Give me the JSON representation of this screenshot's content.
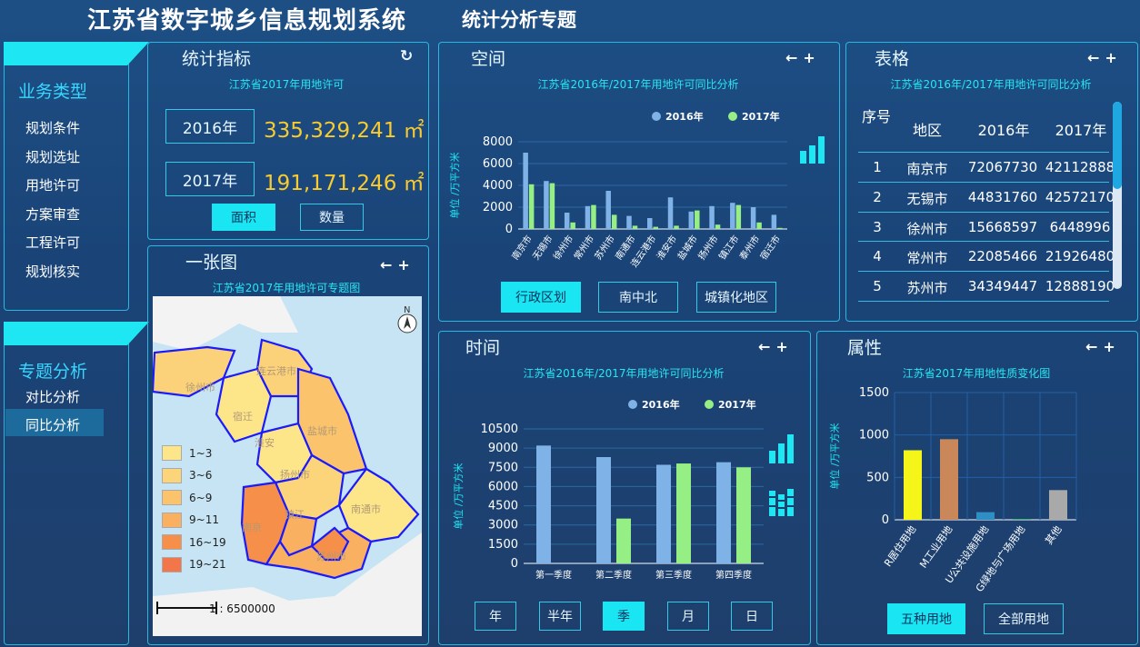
{
  "header": {
    "title": "江苏省数字城乡信息规划系统",
    "subtitle": "统计分析专题"
  },
  "sidebar": {
    "section1": "业务类型",
    "items1": [
      "规划条件",
      "规划选址",
      "用地许可",
      "方案审查",
      "工程许可",
      "规划核实"
    ],
    "section2": "专题分析",
    "items2": [
      "对比分析",
      "同比分析"
    ]
  },
  "stats": {
    "title": "统计指标",
    "subtitle": "江苏省2017年用地许可",
    "row1_year": "2016年",
    "row1_value": "335,329,241 ㎡",
    "row2_year": "2017年",
    "row2_value": "191,171,246 ㎡",
    "btn_area": "面积",
    "btn_count": "数量"
  },
  "map": {
    "title": "一张图",
    "subtitle": "江苏省2017年用地许可专题图",
    "north": "N",
    "scale": "1 : 6500000",
    "legend": [
      "1~3",
      "3~6",
      "6~9",
      "9~11",
      "16~19",
      "19~21"
    ],
    "legend_colors": [
      "#fde58a",
      "#fcd57a",
      "#fbc46c",
      "#f9b060",
      "#f58f4a",
      "#f2764a"
    ],
    "cities": [
      "连云港市",
      "徐州市",
      "宿迁",
      "盐城市",
      "淮安",
      "扬州市",
      "南通市",
      "南京",
      "镇江",
      "苏州市"
    ]
  },
  "space": {
    "title": "空间",
    "subtitle": "江苏省2016年/2017年用地许可同比分析",
    "btns": [
      "行政区划",
      "南中北",
      "城镇化地区"
    ]
  },
  "table": {
    "title": "表格",
    "subtitle": "江苏省2016年/2017年用地许可同比分析",
    "headers": [
      "序号",
      "地区",
      "2016年",
      "2017年"
    ],
    "rows": [
      [
        "1",
        "南京市",
        "72067730",
        "42112888"
      ],
      [
        "2",
        "无锡市",
        "44831760",
        "42572170"
      ],
      [
        "3",
        "徐州市",
        "15668597",
        "6448996"
      ],
      [
        "4",
        "常州市",
        "22085466",
        "21926480"
      ],
      [
        "5",
        "苏州市",
        "34349447",
        "12888190"
      ]
    ]
  },
  "time": {
    "title": "时间",
    "subtitle": "江苏省2016年/2017年用地许可同比分析",
    "btns": [
      "年",
      "半年",
      "季",
      "月",
      "日"
    ]
  },
  "attr": {
    "title": "属性",
    "subtitle": "江苏省2017年用地性质变化图",
    "btns": [
      "五种用地",
      "全部用地"
    ]
  },
  "chart_data": [
    {
      "type": "bar",
      "title": "江苏省2016年/2017年用地许可同比分析",
      "ylabel": "单位 /万平方米",
      "ylim": [
        0,
        8000
      ],
      "yticks": [
        0,
        2000,
        4000,
        6000,
        8000
      ],
      "categories": [
        "南京市",
        "无锡市",
        "徐州市",
        "常州市",
        "苏州市",
        "南通市",
        "连云港市",
        "淮安市",
        "盐城市",
        "扬州市",
        "镇江市",
        "泰州市",
        "宿迁市"
      ],
      "series": [
        {
          "name": "2016年",
          "color": "#7fb3e8",
          "values": [
            7000,
            4400,
            1500,
            2100,
            3500,
            1200,
            1000,
            2900,
            1600,
            2100,
            2400,
            2000,
            1300
          ]
        },
        {
          "name": "2017年",
          "color": "#96ef84",
          "values": [
            4100,
            4200,
            600,
            2200,
            1300,
            300,
            200,
            300,
            1700,
            400,
            2200,
            600,
            100
          ]
        }
      ]
    },
    {
      "type": "bar",
      "title": "江苏省2016年/2017年用地许可同比分析",
      "ylabel": "单位 /万平方米",
      "ylim": [
        0,
        10500
      ],
      "yticks": [
        0,
        1500,
        3000,
        4500,
        6000,
        7500,
        9000,
        10500
      ],
      "categories": [
        "第一季度",
        "第二季度",
        "第三季度",
        "第四季度"
      ],
      "series": [
        {
          "name": "2016年",
          "color": "#7fb3e8",
          "values": [
            9200,
            8300,
            7700,
            7900
          ]
        },
        {
          "name": "2017年",
          "color": "#96ef84",
          "values": [
            0,
            3500,
            7800,
            7500
          ]
        }
      ]
    },
    {
      "type": "bar",
      "title": "江苏省2017年用地性质变化图",
      "ylabel": "单位 /万平方米",
      "ylim": [
        0,
        1500
      ],
      "yticks": [
        0,
        500,
        1000,
        1500
      ],
      "categories": [
        "R居住用地",
        "M工业用地",
        "U公共设施用地",
        "G绿地与广场用地",
        "其他"
      ],
      "values": [
        820,
        950,
        90,
        10,
        350
      ],
      "colors": [
        "#f5f51a",
        "#c9875a",
        "#2f8fc5",
        "#3fbf7a",
        "#a9a9a9"
      ]
    }
  ]
}
